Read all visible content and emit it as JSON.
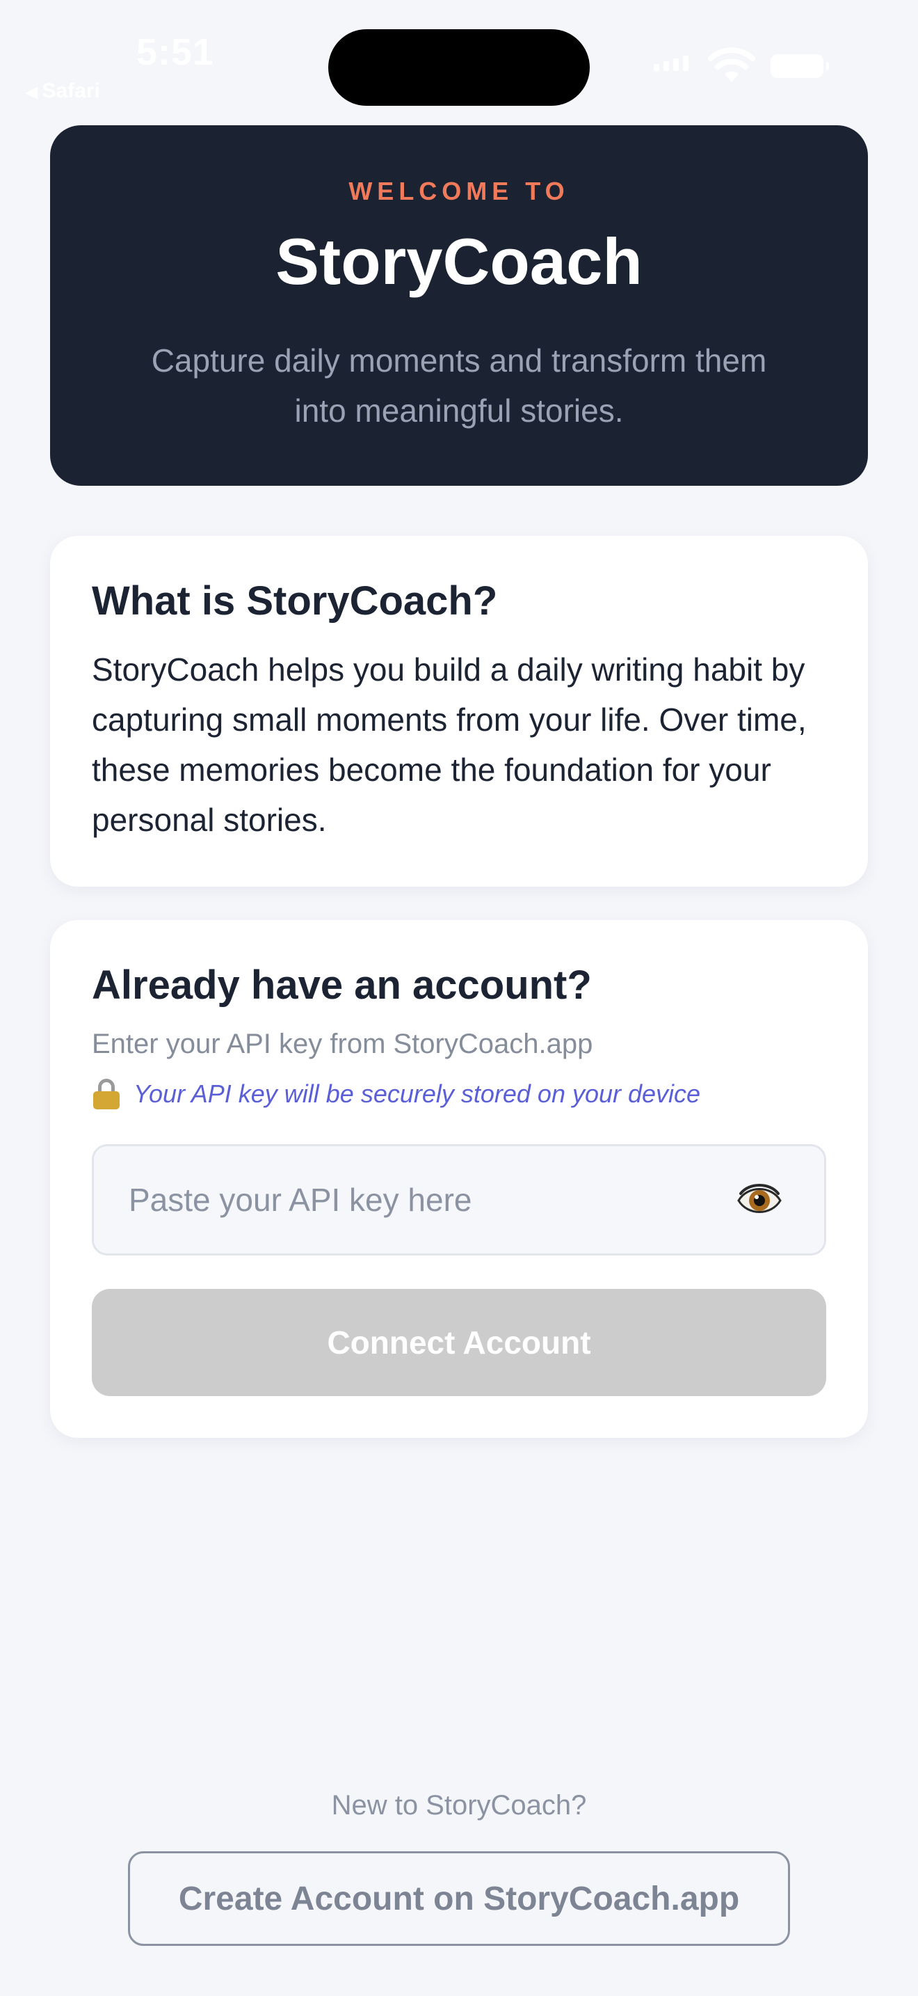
{
  "status_bar": {
    "time": "5:51",
    "back_app": "Safari",
    "back_icon": "back-triangle-icon",
    "color": "#ffffff"
  },
  "hero": {
    "eyebrow": "WELCOME TO",
    "title": "StoryCoach",
    "subtitle": "Capture daily moments and transform them into meaningful stories.",
    "background": "#1b2332",
    "accent": "#f07a5a"
  },
  "info_card": {
    "title": "What is StoryCoach?",
    "body": "StoryCoach helps you build a daily writing habit by capturing small moments from your life. Over time, these memories become the foundation for your personal stories."
  },
  "login_card": {
    "title": "Already have an account?",
    "subtitle": "Enter your API key from StoryCoach.app",
    "secure_note": "Your API key will be securely stored on your device",
    "secure_icon": "lock-icon",
    "api_key": {
      "value": "",
      "placeholder": "Paste your API key here",
      "toggle_icon": "eye-icon"
    },
    "connect_label": "Connect Account",
    "connect_disabled": true,
    "note_color": "#5b5fd6"
  },
  "footer": {
    "prompt": "New to StoryCoach?",
    "create_label": "Create Account on StoryCoach.app"
  }
}
